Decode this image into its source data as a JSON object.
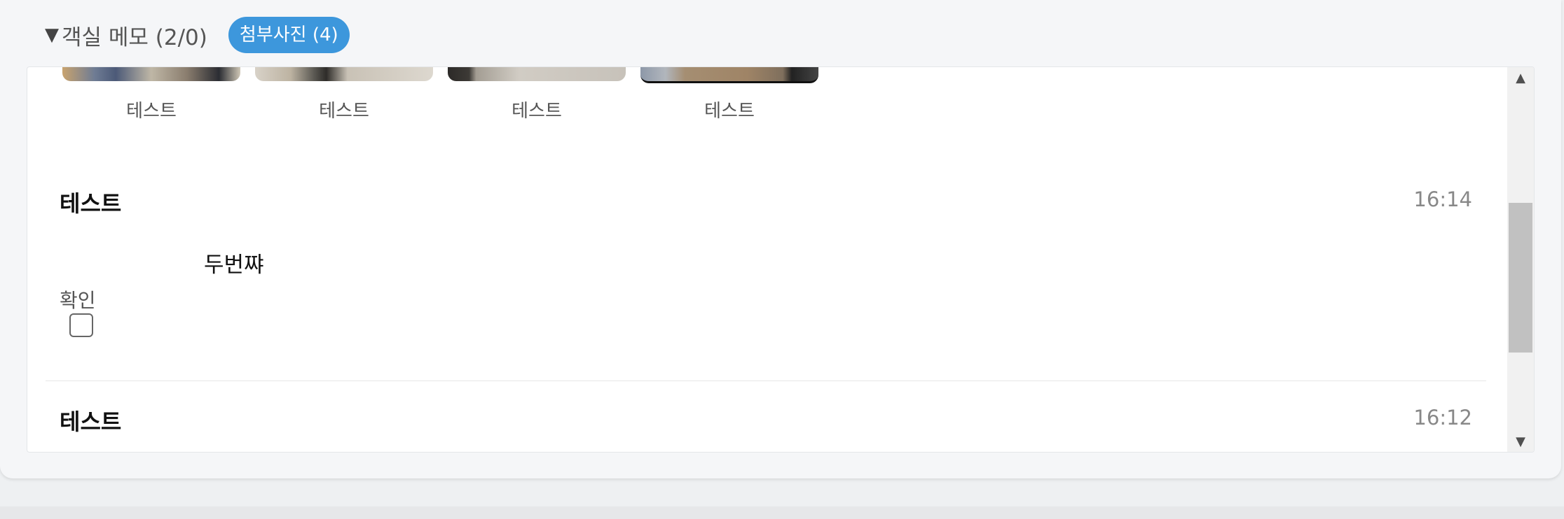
{
  "header": {
    "toggle_icon": "▼",
    "toggle_label": "객실 메모 (2/0)",
    "photos_badge": "첨부사진 (4)"
  },
  "photos": [
    {
      "caption": "테스트",
      "thumb_icon": "photo-thumbnail"
    },
    {
      "caption": "테스트",
      "thumb_icon": "photo-thumbnail"
    },
    {
      "caption": "테스트",
      "thumb_icon": "photo-thumbnail"
    },
    {
      "caption": "테스트",
      "thumb_icon": "photo-thumbnail"
    }
  ],
  "memos": [
    {
      "title": "테스트",
      "time": "16:14",
      "body": "두번쨔",
      "confirm_label": "확인",
      "confirmed": false
    },
    {
      "title": "테스트",
      "time": "16:12"
    }
  ],
  "scrollbar": {
    "up_icon": "▲",
    "down_icon": "▼"
  },
  "colors": {
    "badge": "#3d97dc",
    "panel_bg": "#f5f6f8",
    "memo_bg": "#ffffff",
    "time_text": "#888888"
  }
}
